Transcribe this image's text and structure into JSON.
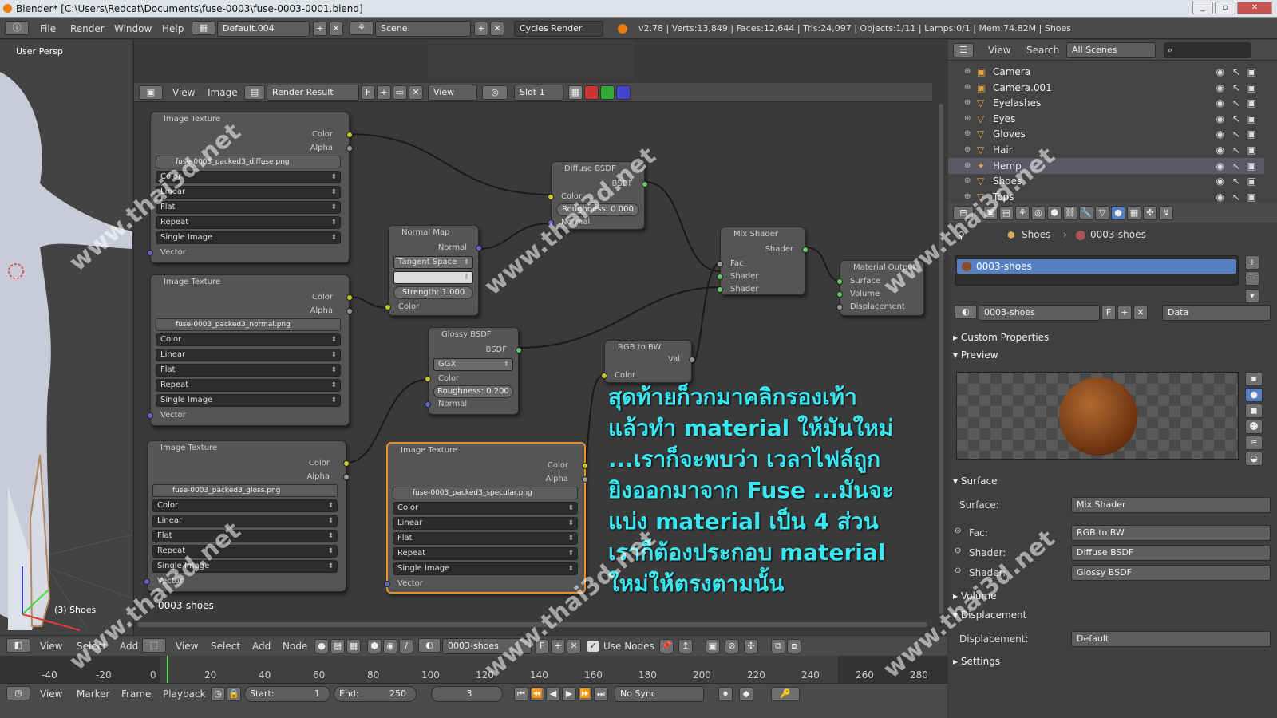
{
  "window": {
    "title": "Blender* [C:\\Users\\Redcat\\Documents\\fuse-0003\\fuse-0003-0001.blend]"
  },
  "infobar": {
    "menus": [
      "File",
      "Render",
      "Window",
      "Help"
    ],
    "screen_layout": "Default.004",
    "scene": "Scene",
    "render_engine": "Cycles Render",
    "stats": "v2.78 | Verts:13,849 | Faces:12,644 | Tris:24,097 | Objects:1/11 | Lamps:0/1 | Mem:74.82M | Shoes"
  },
  "viewport": {
    "label": "User Persp",
    "object_label": "(3) Shoes"
  },
  "image_header": {
    "menus": [
      "View",
      "Image"
    ],
    "image": "Render Result",
    "view": "View",
    "slot": "Slot 1",
    "f": "F"
  },
  "nodes": {
    "tex1": {
      "title": "Image Texture",
      "out_color": "Color",
      "out_alpha": "Alpha",
      "file": "fuse-0003_packed3_diffuse.png",
      "f": "F",
      "opts": [
        "Color",
        "Linear",
        "Flat",
        "Repeat",
        "Single Image"
      ],
      "vector": "Vector"
    },
    "tex2": {
      "title": "Image Texture",
      "out_color": "Color",
      "out_alpha": "Alpha",
      "file": "fuse-0003_packed3_normal.png",
      "f": "F",
      "opts": [
        "Color",
        "Linear",
        "Flat",
        "Repeat",
        "Single Image"
      ],
      "vector": "Vector"
    },
    "tex3": {
      "title": "Image Texture",
      "out_color": "Color",
      "out_alpha": "Alpha",
      "file": "fuse-0003_packed3_gloss.png",
      "f": "F",
      "opts": [
        "Color",
        "Linear",
        "Flat",
        "Repeat",
        "Single Image"
      ],
      "vector": "Vector"
    },
    "tex4": {
      "title": "Image Texture",
      "out_color": "Color",
      "out_alpha": "Alpha",
      "file": "fuse-0003_packed3_specular.png",
      "f": "F",
      "opts": [
        "Color",
        "Linear",
        "Flat",
        "Repeat",
        "Single Image"
      ],
      "vector": "Vector"
    },
    "normalmap": {
      "title": "Normal Map",
      "out": "Normal",
      "space": "Tangent Space",
      "strength": "Strength:",
      "strength_val": "1.000",
      "in_color": "Color"
    },
    "diffuse": {
      "title": "Diffuse BSDF",
      "out": "BSDF",
      "in_color": "Color",
      "roughness": "Roughness:",
      "roughness_val": "0.000",
      "in_normal": "Normal"
    },
    "glossy": {
      "title": "Glossy BSDF",
      "out": "BSDF",
      "dist": "GGX",
      "in_color": "Color",
      "roughness": "Roughness:",
      "roughness_val": "0.200",
      "in_normal": "Normal"
    },
    "rgbbw": {
      "title": "RGB to BW",
      "out": "Val",
      "in_color": "Color"
    },
    "mix": {
      "title": "Mix Shader",
      "out": "Shader",
      "fac": "Fac",
      "sh1": "Shader",
      "sh2": "Shader"
    },
    "output": {
      "title": "Material Output",
      "surface": "Surface",
      "volume": "Volume",
      "displacement": "Displacement"
    }
  },
  "overlay_text": [
    "สุดท้ายก็วกมาคลิกรองเท้า",
    "แล้วทำ material ให้มันใหม่",
    "...เราก็จะพบว่า เวลาไฟล์ถูก",
    "ยิงออกมาจาก Fuse ...มันจะ",
    "แบ่ง material เป็น 4 ส่วน",
    "เราก็ต้องประกอบ material",
    "ใหม่ให้ตรงตามนั้น"
  ],
  "node_material_name": "0003-shoes",
  "node_header": {
    "menus": [
      "View",
      "Select",
      "Add",
      "Node"
    ],
    "material": "0003-shoes",
    "f": "F",
    "use_nodes": "Use Nodes"
  },
  "viewport_header": {
    "menus": [
      "View",
      "Select",
      "Add"
    ]
  },
  "timeline": {
    "ticks": [
      "-40",
      "-20",
      "0",
      "20",
      "40",
      "60",
      "80",
      "100",
      "120",
      "140",
      "160",
      "180",
      "200",
      "220",
      "240",
      "260",
      "280"
    ],
    "menus": [
      "View",
      "Marker",
      "Frame",
      "Playback"
    ],
    "start": "Start:",
    "start_val": "1",
    "end": "End:",
    "end_val": "250",
    "current": "3",
    "sync": "No Sync"
  },
  "outliner": {
    "menus": [
      "View",
      "Search"
    ],
    "filter": "All Scenes",
    "items": [
      "Camera",
      "Camera.001",
      "Eyelashes",
      "Eyes",
      "Gloves",
      "Hair",
      "Hemp",
      "Shoes",
      "Tops"
    ]
  },
  "properties": {
    "breadcrumb": [
      "Shoes",
      "0003-shoes"
    ],
    "slot": "0003-shoes",
    "material_field": "0003-shoes",
    "f": "F",
    "link": "Data",
    "custom_props": "Custom Properties",
    "preview": "Preview",
    "surface_section": "Surface",
    "surface_label": "Surface:",
    "surface_val": "Mix Shader",
    "fac_label": "Fac:",
    "fac_val": "RGB to BW",
    "shader1_label": "Shader:",
    "shader1_val": "Diffuse BSDF",
    "shader2_label": "Shader:",
    "shader2_val": "Glossy BSDF",
    "volume": "Volume",
    "displacement_section": "Displacement",
    "displacement_label": "Displacement:",
    "displacement_val": "Default",
    "settings": "Settings"
  },
  "watermark": "www.thai3d.net",
  "colors": {
    "overlay": "#3ae6f0",
    "selected": "#5680c2",
    "socket_color": "#c7c729",
    "socket_shader": "#63c763"
  }
}
